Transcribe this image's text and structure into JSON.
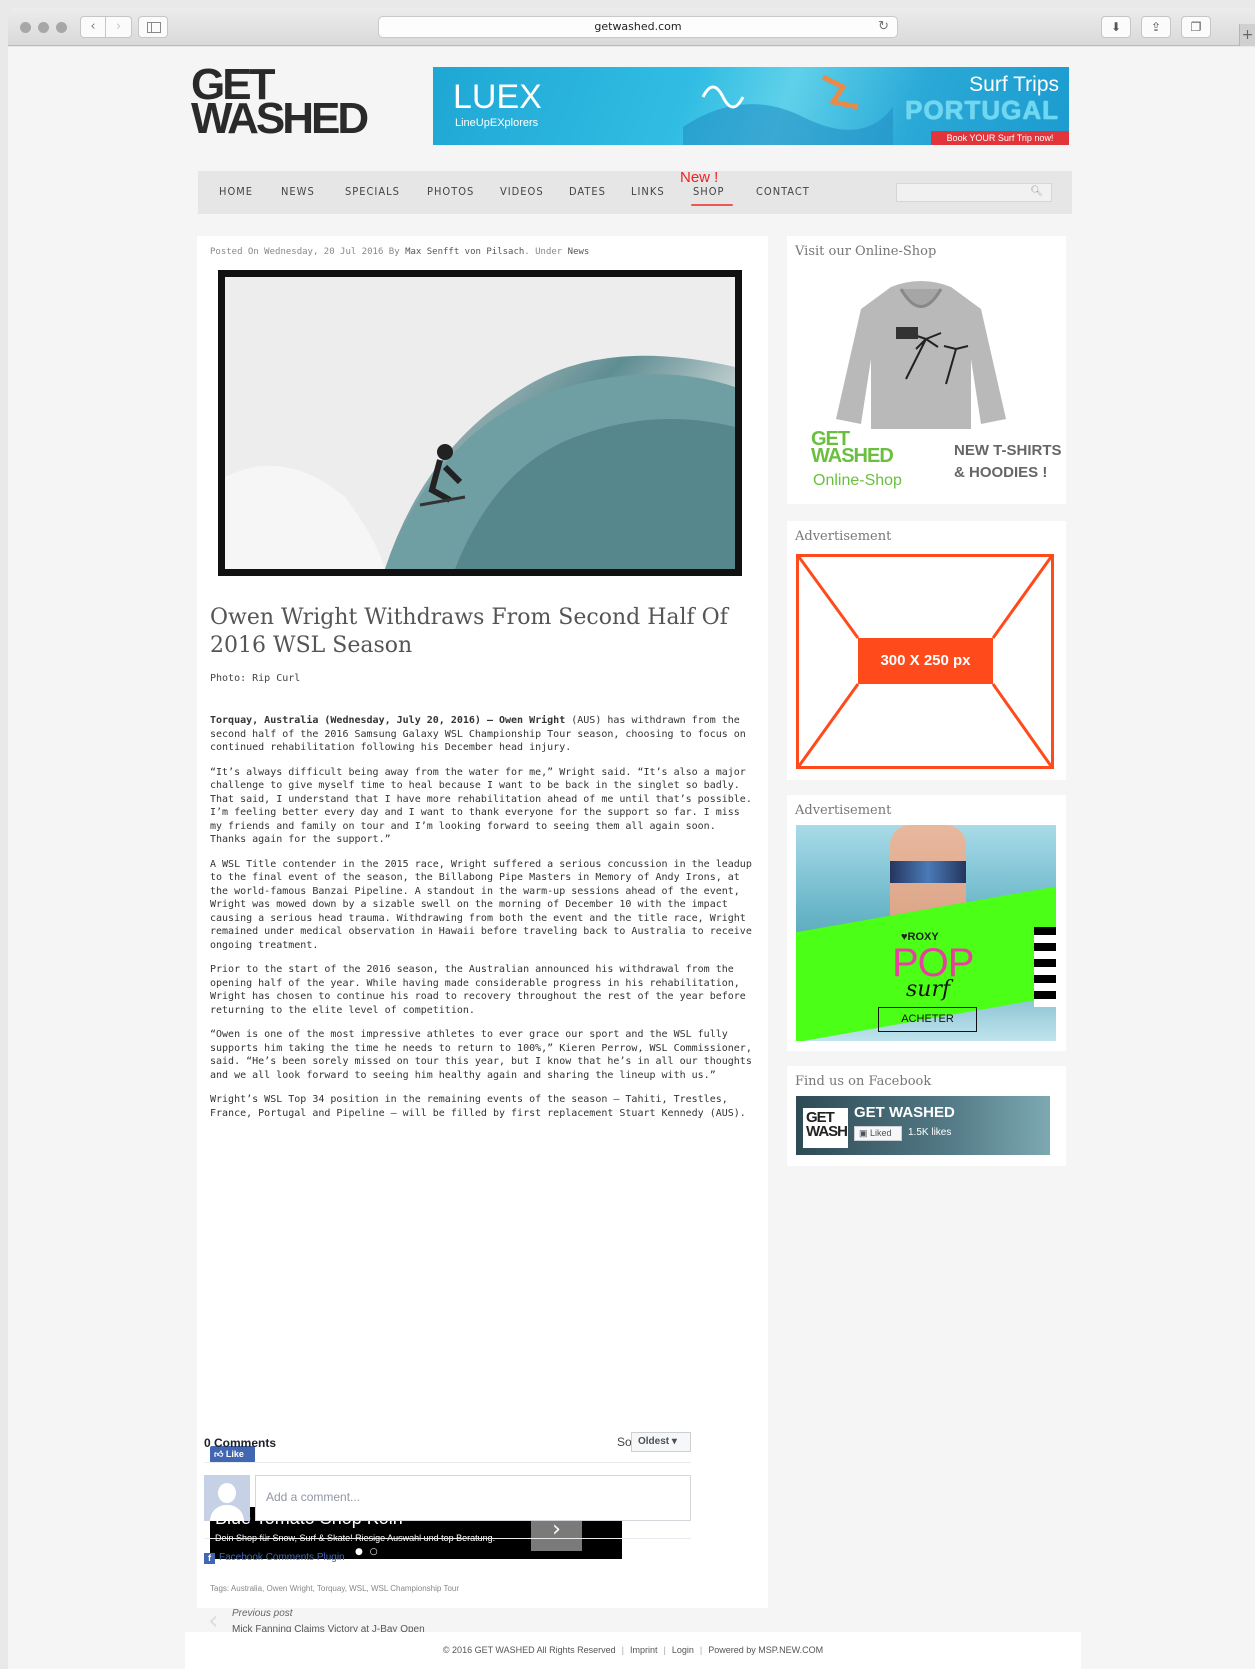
{
  "browser": {
    "url": "getwashed.com"
  },
  "site": {
    "logo_text": [
      "GET",
      "WASHED"
    ]
  },
  "top_banner": {
    "brand": "LUEX",
    "brand_sub": "LineUpEXplorers",
    "headline": "Surf Trips",
    "destination": "PORTUGAL",
    "cta": "Book YOUR Surf Trip now!"
  },
  "nav": {
    "items": [
      "HOME",
      "NEWS",
      "SPECIALS",
      "PHOTOS",
      "VIDEOS",
      "DATES",
      "LINKS",
      "SHOP",
      "CONTACT"
    ],
    "new_badge": "New !"
  },
  "article": {
    "meta": {
      "prefix": "Posted On Wednesday, 20 Jul 2016 By ",
      "author": "Max Senfft von Pilsach",
      "middle": ". Under ",
      "category": "News"
    },
    "title": "Owen Wright Withdraws From Second Half Of 2016 WSL Season",
    "photo_credit": "Photo: Rip Curl",
    "lead_bold": "Torquay, Australia (Wednesday, July 20, 2016) – Owen Wright",
    "lead_rest": " (AUS) has withdrawn from the second half of the 2016 Samsung Galaxy WSL Championship Tour season, choosing to focus on continued rehabilitation following his December head injury.",
    "paragraphs": [
      "“It’s always difficult being away from the water for me,” Wright said. “It’s also a major challenge to give myself time to heal because I want to be back in the singlet so badly. That said, I understand that I have more rehabilitation ahead of me until that’s possible. I’m feeling better every day and I want to thank everyone for the support so far. I miss my friends and family on tour and I’m looking forward to seeing them all again soon. Thanks again for the support.”",
      "A WSL Title contender in the 2015 race, Wright suffered a serious concussion in the leadup to the final event of the season, the Billabong Pipe Masters in Memory of Andy Irons, at the world-famous Banzai Pipeline. A standout in the warm-up sessions ahead of the event, Wright was mowed down by a sizable swell on the morning of December 10 with the impact causing a serious head trauma. Withdrawing from both the event and the title race, Wright remained under medical observation in Hawaii before traveling back to Australia to receive ongoing treatment.",
      "Prior to the start of the 2016 season, the Australian announced his withdrawal from the opening half of the year. While having made considerable progress in his rehabilitation, Wright has chosen to continue his road to recovery throughout the rest of the year before returning to the elite level of competition.",
      "“Owen is one of the most impressive athletes to ever grace our sport and the WSL fully supports him taking the time he needs to return to 100%,” Kieren Perrow, WSL Commissioner, said. “He’s been sorely missed on tour this year, but I know that he’s in all our thoughts and we all look forward to seeing him healthy again and sharing the lineup with us.”",
      "Wright’s WSL Top 34 position in the remaining events of the season – Tahiti, Trestles, France, Portugal and Pipeline – will be filled by first replacement Stuart Kennedy (AUS)."
    ],
    "like_label": "Like",
    "ad": {
      "title": "Blue Tomato Shop Köln",
      "text": "Dein Shop für Snow, Surf & Skate! Riesige Auswahl und top Beratung.",
      "dots": "● ○",
      "arrow": "›",
      "adchoices": "▷✕"
    },
    "prev_post": {
      "label": "Previous post",
      "title": "Mick Fanning Claims Victory at J-Bay Open"
    },
    "comments": {
      "count": "0 Comments",
      "sort_label": "Sort by",
      "sort_value": "Oldest ▾",
      "placeholder": "Add a comment...",
      "plugin": "Facebook Comments Plugin"
    },
    "tags": "Tags: Australia, Owen Wright, Torquay, WSL, WSL Championship Tour"
  },
  "sidebar": {
    "shop": {
      "title": "Visit our Online-Shop",
      "logo": [
        "GET",
        "WASHED"
      ],
      "logo_sub": "Online-Shop",
      "promo": [
        "NEW T-SHIRTS",
        "& HOODIES !"
      ]
    },
    "ad1": {
      "title": "Advertisement",
      "label": "300 X 250 px"
    },
    "ad2": {
      "title": "Advertisement",
      "brand": "♥ROXY",
      "pop": "POP",
      "surf": "surf",
      "cta": "ACHETER"
    },
    "facebook": {
      "title": "Find us on Facebook",
      "logo": [
        "GET",
        "WASH"
      ],
      "page_name": "GET WASHED",
      "liked": "Liked",
      "likes": "1.5K likes"
    }
  },
  "footer": {
    "copyright": "© 2016 GET WASHED  All Rights Reserved",
    "links": [
      "Imprint",
      "Login",
      "Powered by MSP.NEW.COM"
    ]
  },
  "colors": {
    "nav_bg": "#e6e6e6",
    "accent_red": "#e22222",
    "ad_orange": "#ff4a1c",
    "fb_blue": "#4267b2",
    "shop_green": "#6bbf3f",
    "roxy_green": "#4cff17"
  }
}
